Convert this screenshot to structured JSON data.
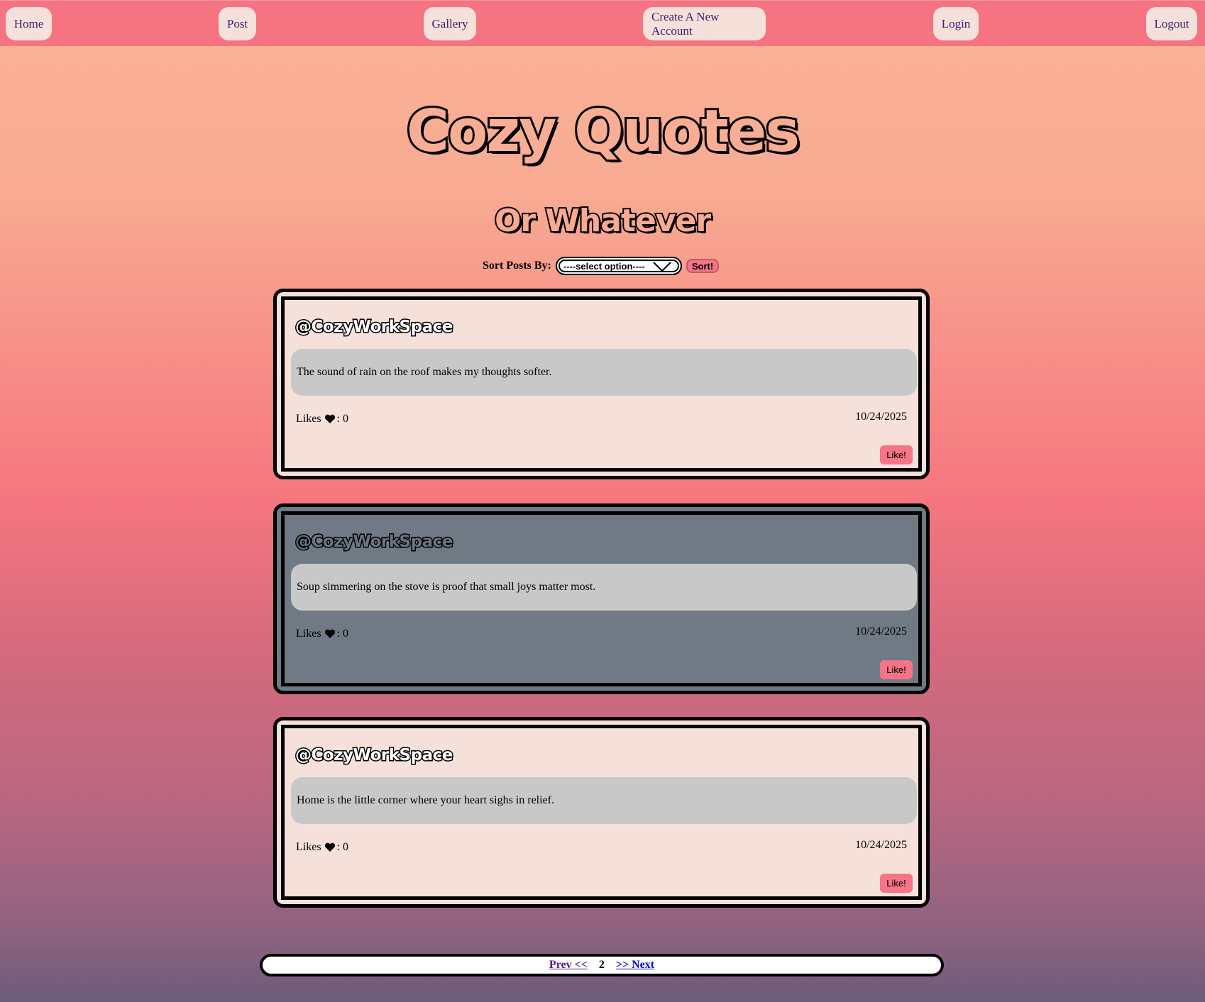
{
  "nav": {
    "home": "Home",
    "post": "Post",
    "gallery": "Gallery",
    "create_account": "Create A New Account",
    "login": "Login",
    "logout": "Logout"
  },
  "hero": {
    "title": "Cozy Quotes",
    "subtitle": "Or Whatever"
  },
  "sort": {
    "label": "Sort Posts By:",
    "selected": "----select option----",
    "button": "Sort!"
  },
  "posts": [
    {
      "author": "@CozyWorkSpace",
      "body": "The sound of rain on the roof makes my thoughts softer.",
      "likes_label": "Likes",
      "likes_count": ": 0",
      "date": "10/24/2025",
      "like_button": "Like!",
      "theme": "light"
    },
    {
      "author": "@CozyWorkSpace",
      "body": "Soup simmering on the stove is proof that small joys matter most.",
      "likes_label": "Likes",
      "likes_count": ": 0",
      "date": "10/24/2025",
      "like_button": "Like!",
      "theme": "dark"
    },
    {
      "author": "@CozyWorkSpace",
      "body": "Home is the little corner where your heart sighs in relief.",
      "likes_label": "Likes",
      "likes_count": ": 0",
      "date": "10/24/2025",
      "like_button": "Like!",
      "theme": "light"
    }
  ],
  "pagination": {
    "prev": "Prev <<",
    "current": "2",
    "next": ">> Next"
  },
  "colors": {
    "nav_bar": "#f67482",
    "nav_button": "#f5e1da",
    "nav_text": "#3d2070",
    "card_light": "#f5e1da",
    "card_dark": "#707a84",
    "quote_box": "#c8c8c8",
    "accent_button": "#f57485"
  },
  "icons": {
    "likes": "heart-icon",
    "dropdown": "chevron-down-icon"
  }
}
